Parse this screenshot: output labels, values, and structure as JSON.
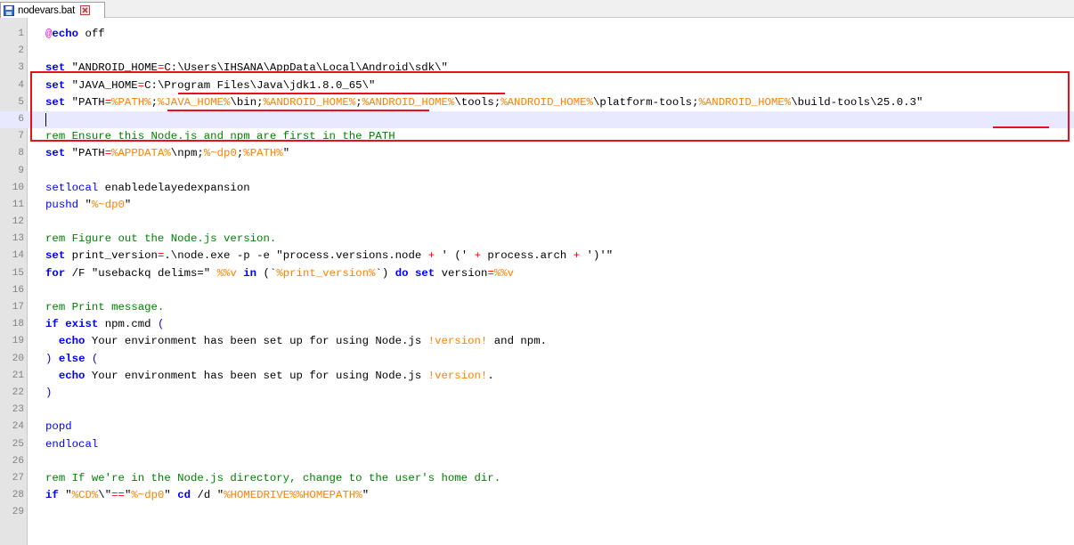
{
  "tab": {
    "title": "nodevars.bat",
    "icon": "save-icon",
    "close_icon": "close-icon"
  },
  "colors": {
    "keyword": "#0000ff",
    "label": "#ff00ff",
    "variable": "#ff8000",
    "operator": "#ff0000",
    "comment": "#008000",
    "annotation": "#e8101c"
  },
  "current_line": 6,
  "lines": [
    {
      "n": "1",
      "tokens": [
        [
          "lbl",
          "@"
        ],
        [
          "kw",
          "echo"
        ],
        [
          "",
          ""
        ],
        [
          "str",
          " off"
        ]
      ]
    },
    {
      "n": "2",
      "tokens": []
    },
    {
      "n": "3",
      "tokens": [
        [
          "kw",
          "set"
        ],
        [
          "str",
          " \"ANDROID_HOME"
        ],
        [
          "op",
          "="
        ],
        [
          "str",
          "C:\\Users\\IHSANA\\AppData\\Local\\Android\\sdk\\\""
        ]
      ]
    },
    {
      "n": "4",
      "tokens": [
        [
          "kw",
          "set"
        ],
        [
          "str",
          " \"JAVA_HOME"
        ],
        [
          "op",
          "="
        ],
        [
          "str",
          "C:\\Program Files\\Java\\jdk1.8.0_65\\\""
        ]
      ]
    },
    {
      "n": "5",
      "tokens": [
        [
          "kw",
          "set"
        ],
        [
          "str",
          " \"PATH"
        ],
        [
          "op",
          "="
        ],
        [
          "var",
          "%PATH%"
        ],
        [
          "str",
          ";"
        ],
        [
          "var",
          "%JAVA_HOME%"
        ],
        [
          "str",
          "\\bin;"
        ],
        [
          "var",
          "%ANDROID_HOME%"
        ],
        [
          "str",
          ";"
        ],
        [
          "var",
          "%ANDROID_HOME%"
        ],
        [
          "str",
          "\\tools;"
        ],
        [
          "var",
          "%ANDROID_HOME%"
        ],
        [
          "str",
          "\\platform-tools;"
        ],
        [
          "var",
          "%ANDROID_HOME%"
        ],
        [
          "str",
          "\\build-tools\\25.0.3\""
        ]
      ]
    },
    {
      "n": "6",
      "tokens": []
    },
    {
      "n": "7",
      "tokens": [
        [
          "cmt",
          "rem Ensure this Node.js and npm are first in the PATH"
        ]
      ]
    },
    {
      "n": "8",
      "tokens": [
        [
          "kw",
          "set"
        ],
        [
          "str",
          " \"PATH"
        ],
        [
          "op",
          "="
        ],
        [
          "var",
          "%APPDATA%"
        ],
        [
          "str",
          "\\npm;"
        ],
        [
          "var",
          "%~dp0"
        ],
        [
          "str",
          ";"
        ],
        [
          "var",
          "%PATH%"
        ],
        [
          "str",
          "\""
        ]
      ]
    },
    {
      "n": "9",
      "tokens": []
    },
    {
      "n": "10",
      "tokens": [
        [
          "kw2",
          "setlocal"
        ],
        [
          "str",
          " enabledelayedexpansion"
        ]
      ]
    },
    {
      "n": "11",
      "tokens": [
        [
          "kw2",
          "pushd"
        ],
        [
          "str",
          " \""
        ],
        [
          "var",
          "%~dp0"
        ],
        [
          "str",
          "\""
        ]
      ]
    },
    {
      "n": "12",
      "tokens": []
    },
    {
      "n": "13",
      "tokens": [
        [
          "cmt",
          "rem Figure out the Node.js version."
        ]
      ]
    },
    {
      "n": "14",
      "tokens": [
        [
          "kw",
          "set"
        ],
        [
          "str",
          " print_version"
        ],
        [
          "op",
          "="
        ],
        [
          "str",
          ".\\node.exe -p -e \"process.versions.node "
        ],
        [
          "op",
          "+"
        ],
        [
          "str",
          " ' (' "
        ],
        [
          "op",
          "+"
        ],
        [
          "str",
          " process.arch "
        ],
        [
          "op",
          "+"
        ],
        [
          "str",
          " ')'\""
        ]
      ]
    },
    {
      "n": "15",
      "tokens": [
        [
          "kw",
          "for"
        ],
        [
          "str",
          " /F \"usebackq delims=\" "
        ],
        [
          "var",
          "%%v"
        ],
        [
          "str",
          " "
        ],
        [
          "kw",
          "in"
        ],
        [
          "str",
          " (`"
        ],
        [
          "var",
          "%print_version%"
        ],
        [
          "str",
          "`) "
        ],
        [
          "kw",
          "do"
        ],
        [
          "str",
          " "
        ],
        [
          "kw",
          "set"
        ],
        [
          "str",
          " version"
        ],
        [
          "op",
          "="
        ],
        [
          "var",
          "%%v"
        ]
      ]
    },
    {
      "n": "16",
      "tokens": []
    },
    {
      "n": "17",
      "tokens": [
        [
          "cmt",
          "rem Print message."
        ]
      ]
    },
    {
      "n": "18",
      "tokens": [
        [
          "kw",
          "if"
        ],
        [
          "str",
          " "
        ],
        [
          "kw",
          "exist"
        ],
        [
          "str",
          " npm.cmd "
        ],
        [
          "kw2",
          "("
        ]
      ]
    },
    {
      "n": "19",
      "tokens": [
        [
          "str",
          "  "
        ],
        [
          "kw",
          "echo"
        ],
        [
          "str",
          " Your environment has been set up for using Node.js "
        ],
        [
          "var",
          "!version!"
        ],
        [
          "str",
          " and npm."
        ]
      ]
    },
    {
      "n": "20",
      "tokens": [
        [
          "kw2",
          ")"
        ],
        [
          "str",
          " "
        ],
        [
          "kw",
          "else"
        ],
        [
          "str",
          " "
        ],
        [
          "kw2",
          "("
        ]
      ]
    },
    {
      "n": "21",
      "tokens": [
        [
          "str",
          "  "
        ],
        [
          "kw",
          "echo"
        ],
        [
          "str",
          " Your environment has been set up for using Node.js "
        ],
        [
          "var",
          "!version!"
        ],
        [
          "str",
          "."
        ]
      ]
    },
    {
      "n": "22",
      "tokens": [
        [
          "kw2",
          ")"
        ]
      ]
    },
    {
      "n": "23",
      "tokens": []
    },
    {
      "n": "24",
      "tokens": [
        [
          "kw2",
          "popd"
        ]
      ]
    },
    {
      "n": "25",
      "tokens": [
        [
          "kw2",
          "endlocal"
        ]
      ]
    },
    {
      "n": "26",
      "tokens": []
    },
    {
      "n": "27",
      "tokens": [
        [
          "cmt",
          "rem If we're in the Node.js directory, change to the user's home dir."
        ]
      ]
    },
    {
      "n": "28",
      "tokens": [
        [
          "kw",
          "if"
        ],
        [
          "str",
          " \""
        ],
        [
          "var",
          "%CD%"
        ],
        [
          "str",
          "\\\""
        ],
        [
          "op",
          "=="
        ],
        [
          "str",
          "\""
        ],
        [
          "var",
          "%~dp0"
        ],
        [
          "str",
          "\" "
        ],
        [
          "kw",
          "cd"
        ],
        [
          "str",
          " /d \""
        ],
        [
          "var",
          "%HOMEDRIVE%%HOMEPATH%"
        ],
        [
          "str",
          "\""
        ]
      ]
    },
    {
      "n": "29",
      "tokens": []
    }
  ]
}
